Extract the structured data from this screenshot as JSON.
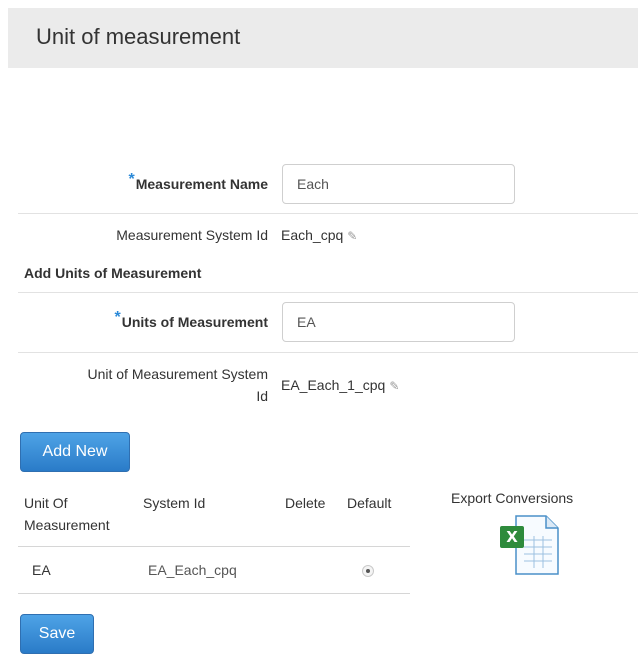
{
  "header": {
    "title": "Unit of measurement"
  },
  "form": {
    "measurement_name_label": "Measurement Name",
    "measurement_name_value": "Each",
    "measurement_system_id_label": "Measurement System Id",
    "measurement_system_id_value": "Each_cpq",
    "add_units_title": "Add Units of Measurement",
    "units_label": "Units of Measurement",
    "units_value": "EA",
    "uom_system_id_label_line1": "Unit of Measurement System",
    "uom_system_id_label_line2": "Id",
    "uom_system_id_value": "EA_Each_1_cpq",
    "required_marker": "*",
    "edit_icon": "pencil-icon"
  },
  "buttons": {
    "add_new": "Add New",
    "save": "Save"
  },
  "table": {
    "headers": {
      "unit_line1": "Unit Of",
      "unit_line2": "Measurement",
      "system_id": "System Id",
      "delete": "Delete",
      "default": "Default"
    },
    "rows": [
      {
        "unit": "EA",
        "system_id": "EA_Each_cpq",
        "default_selected": true
      }
    ]
  },
  "export": {
    "label": "Export Conversions",
    "icon": "excel-file-icon"
  },
  "colors": {
    "accent": "#2c8ad8",
    "button": "#2a7bc8",
    "header_bg": "#ebebeb"
  }
}
